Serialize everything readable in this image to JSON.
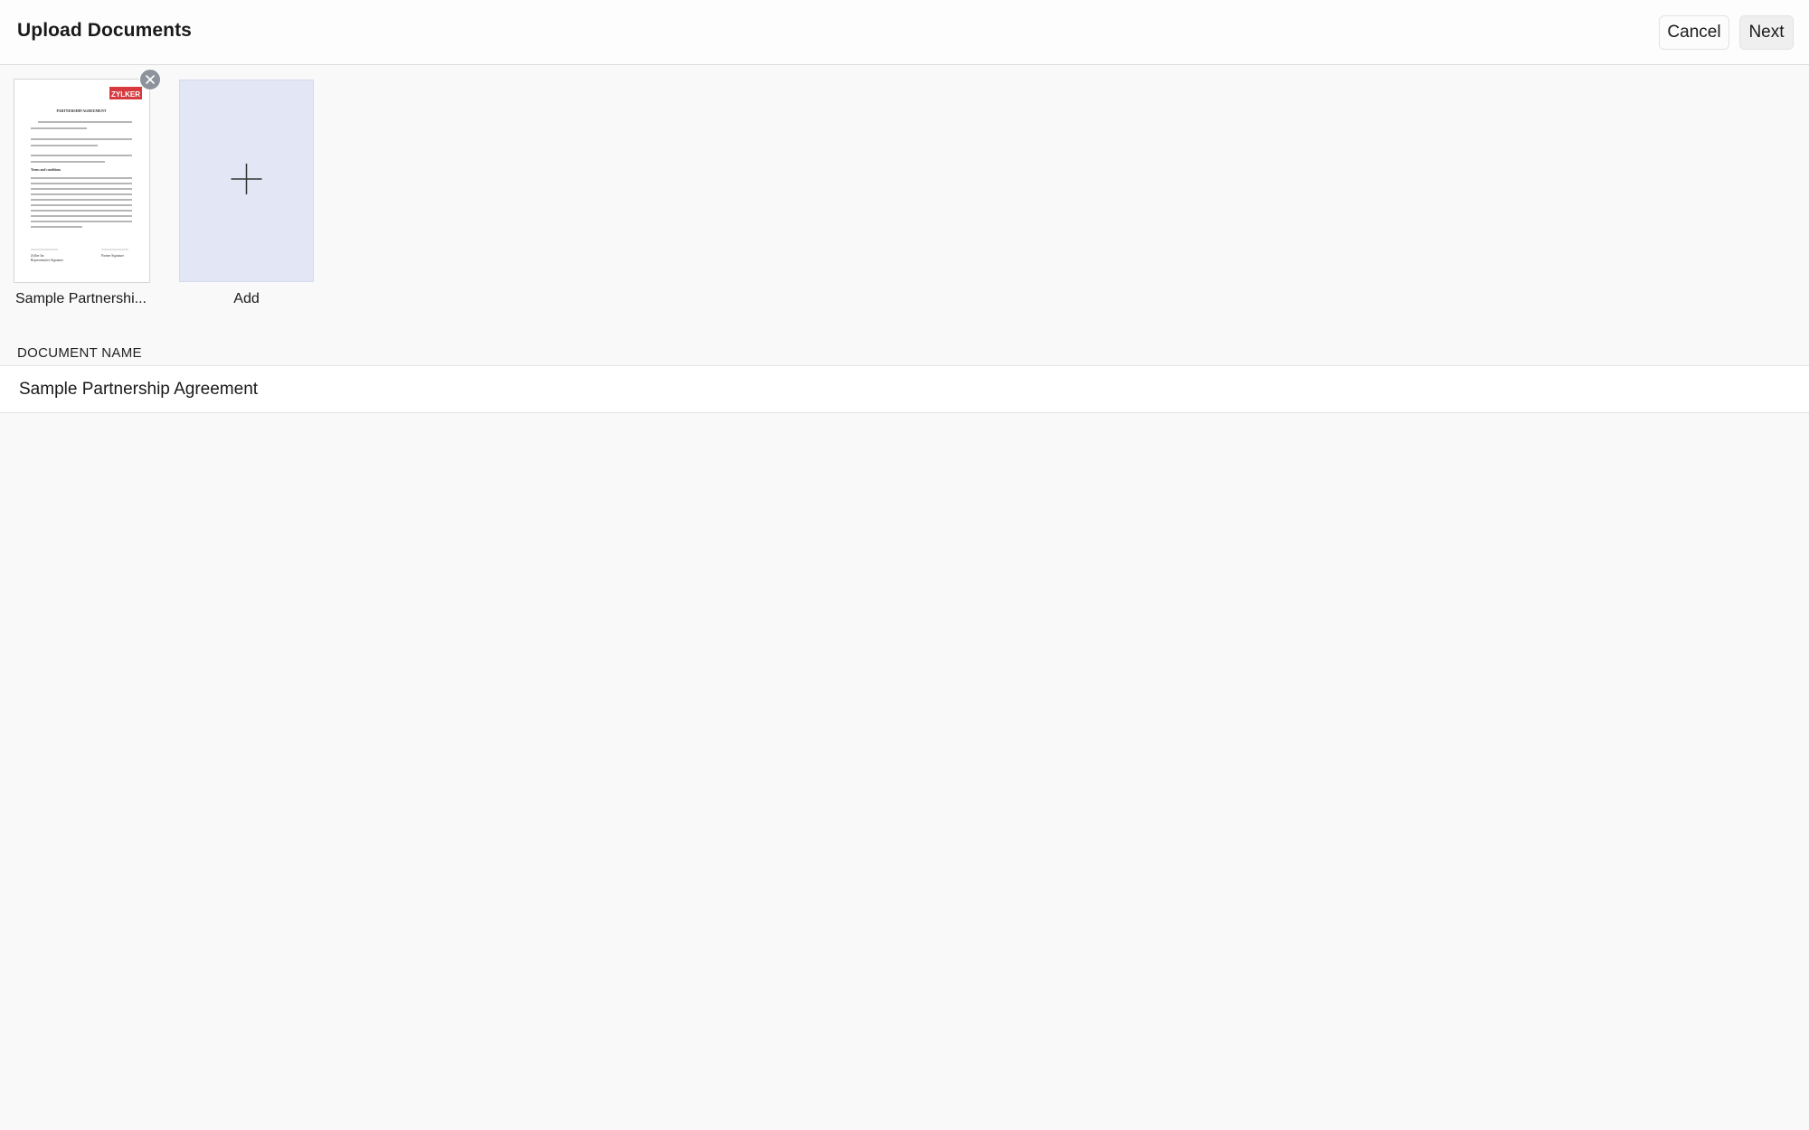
{
  "header": {
    "title": "Upload Documents",
    "cancel_label": "Cancel",
    "next_label": "Next"
  },
  "documents": [
    {
      "name": "Sample Partnership Agreement",
      "thumbnail_label": "Sample Partnershi...",
      "preview": {
        "logo_text": "ZYLKER",
        "heading": "PARTNERSHIP AGREEMENT",
        "section_heading": "Terms and conditions",
        "signature_left": "Zylker Inc",
        "signature_left_sub": "Representative Signature",
        "signature_right": "Partner Signature"
      }
    }
  ],
  "add_tile": {
    "label": "Add",
    "icon": "plus-icon"
  },
  "form": {
    "document_name_label": "DOCUMENT NAME",
    "document_name_value": "Sample Partnership Agreement"
  },
  "colors": {
    "logo_red": "#d63a3f",
    "add_tile_bg": "#e3e7f5",
    "remove_badge": "#8c939b"
  }
}
